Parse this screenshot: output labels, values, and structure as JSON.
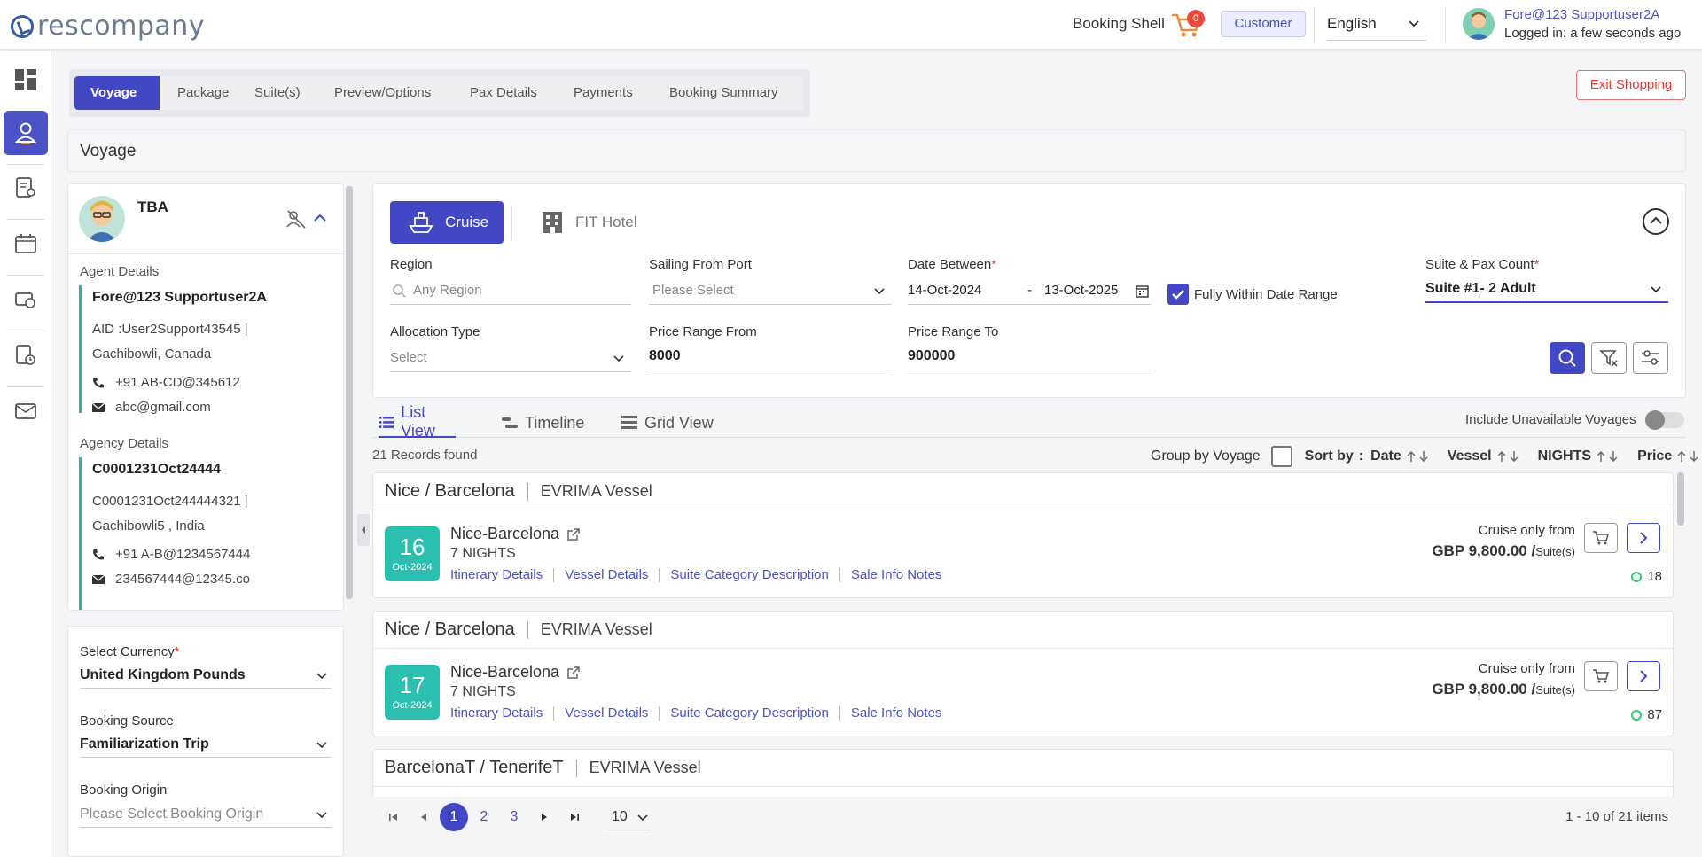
{
  "header": {
    "logo": "rescompany",
    "booking_shell": "Booking Shell",
    "cart_count": "0",
    "role_badge": "Customer",
    "language": "English",
    "user_name": "Fore@123 Supportuser2A",
    "user_status": "Logged in: a few seconds ago"
  },
  "steps": [
    "Voyage",
    "Package",
    "Suite(s)",
    "Preview/Options",
    "Pax Details",
    "Payments",
    "Booking Summary"
  ],
  "exit_label": "Exit Shopping",
  "page_title": "Voyage",
  "agent": {
    "name": "TBA",
    "agent_heading": "Agent Details",
    "agent_name": "Fore@123 Supportuser2A",
    "agent_aid": "AID :User2Support43545 |",
    "agent_location": "Gachibowli, Canada",
    "agent_phone": "+91 AB-CD@345612",
    "agent_email": "abc@gmail.com",
    "agency_heading": "Agency Details",
    "agency_code": "C0001231Oct24444",
    "agency_ref": "C0001231Oct244444321 |",
    "agency_location": "Gachibowli5 , India",
    "agency_phone": "+91 A-B@1234567444",
    "agency_email": "234567444@12345.co"
  },
  "booking_form": {
    "currency_label": "Select Currency",
    "currency_value": "United Kingdom Pounds",
    "source_label": "Booking Source",
    "source_value": "Familiarization Trip",
    "origin_label": "Booking Origin",
    "origin_placeholder": "Please Select Booking Origin"
  },
  "filters": {
    "cruise_label": "Cruise",
    "fit_label": "FIT Hotel",
    "region_label": "Region",
    "region_placeholder": "Any Region",
    "port_label": "Sailing From Port",
    "port_placeholder": "Please Select",
    "date_label": "Date Between",
    "date_from": "14-Oct-2024",
    "date_dash": "-",
    "date_to": "13-Oct-2025",
    "within_label": "Fully Within Date Range",
    "suite_label": "Suite & Pax Count",
    "suite_value": "Suite #1- 2 Adult",
    "allocation_label": "Allocation Type",
    "allocation_placeholder": "Select",
    "price_from_label": "Price Range From",
    "price_from": "8000",
    "price_to_label": "Price Range To",
    "price_to": "900000"
  },
  "tabs": [
    "List View",
    "Timeline",
    "Grid View"
  ],
  "include_unavailable": "Include Unavailable Voyages",
  "records_found": "21 Records found",
  "sort": {
    "group_by": "Group by Voyage",
    "sort_by": "Sort by",
    "colon": ":",
    "date": "Date",
    "vessel": "Vessel",
    "nights": "NIGHTS",
    "price": "Price"
  },
  "voyages": [
    {
      "route": "Nice / Barcelona",
      "vessel": "EVRIMA Vessel",
      "day": "16",
      "month": "Oct-2024",
      "title": "Nice-Barcelona",
      "nights": "7 NIGHTS",
      "links": [
        "Itinerary Details",
        "Vessel Details",
        "Suite Category Description",
        "Sale Info Notes"
      ],
      "from_label": "Cruise only from",
      "price": "GBP 9,800.00 /",
      "price_unit": "Suite(s)",
      "availability": "18"
    },
    {
      "route": "Nice / Barcelona",
      "vessel": "EVRIMA Vessel",
      "day": "17",
      "month": "Oct-2024",
      "title": "Nice-Barcelona",
      "nights": "7 NIGHTS",
      "links": [
        "Itinerary Details",
        "Vessel Details",
        "Suite Category Description",
        "Sale Info Notes"
      ],
      "from_label": "Cruise only from",
      "price": "GBP 9,800.00 /",
      "price_unit": "Suite(s)",
      "availability": "87"
    },
    {
      "route": "BarcelonaT / TenerifeT",
      "vessel": "EVRIMA Vessel"
    }
  ],
  "pagination": {
    "pages": [
      "1",
      "2",
      "3"
    ],
    "per_page": "10",
    "info": "1 - 10 of 21 items"
  },
  "colors": {
    "primary": "#4248c4",
    "teal": "#2bbfb0",
    "danger": "#e53935"
  }
}
